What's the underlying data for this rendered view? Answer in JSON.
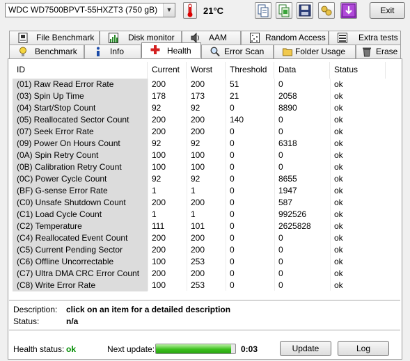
{
  "toolbar": {
    "drive": "WDC WD7500BPVT-55HXZT3 (750 gB)",
    "temperature": "21°C",
    "exit_label": "Exit"
  },
  "tabs_top": [
    {
      "label": "File Benchmark",
      "icon": "file-benchmark-icon"
    },
    {
      "label": "Disk monitor",
      "icon": "disk-monitor-icon"
    },
    {
      "label": "AAM",
      "icon": "speaker-icon"
    },
    {
      "label": "Random Access",
      "icon": "random-access-icon"
    },
    {
      "label": "Extra tests",
      "icon": "extra-tests-icon"
    }
  ],
  "tabs_bottom": [
    {
      "label": "Benchmark",
      "icon": "lightbulb-icon"
    },
    {
      "label": "Info",
      "icon": "info-icon"
    },
    {
      "label": "Health",
      "icon": "health-cross-icon",
      "active": true
    },
    {
      "label": "Error Scan",
      "icon": "magnifier-icon"
    },
    {
      "label": "Folder Usage",
      "icon": "folder-icon"
    },
    {
      "label": "Erase",
      "icon": "trash-icon"
    }
  ],
  "table": {
    "headers": [
      "ID",
      "Current",
      "Worst",
      "Threshold",
      "Data",
      "Status"
    ],
    "rows": [
      [
        "(01) Raw Read Error Rate",
        "200",
        "200",
        "51",
        "0",
        "ok"
      ],
      [
        "(03) Spin Up Time",
        "178",
        "173",
        "21",
        "2058",
        "ok"
      ],
      [
        "(04) Start/Stop Count",
        "92",
        "92",
        "0",
        "8890",
        "ok"
      ],
      [
        "(05) Reallocated Sector Count",
        "200",
        "200",
        "140",
        "0",
        "ok"
      ],
      [
        "(07) Seek Error Rate",
        "200",
        "200",
        "0",
        "0",
        "ok"
      ],
      [
        "(09) Power On Hours Count",
        "92",
        "92",
        "0",
        "6318",
        "ok"
      ],
      [
        "(0A) Spin Retry Count",
        "100",
        "100",
        "0",
        "0",
        "ok"
      ],
      [
        "(0B) Calibration Retry Count",
        "100",
        "100",
        "0",
        "0",
        "ok"
      ],
      [
        "(0C) Power Cycle Count",
        "92",
        "92",
        "0",
        "8655",
        "ok"
      ],
      [
        "(BF) G-sense Error Rate",
        "1",
        "1",
        "0",
        "1947",
        "ok"
      ],
      [
        "(C0) Unsafe Shutdown Count",
        "200",
        "200",
        "0",
        "587",
        "ok"
      ],
      [
        "(C1) Load Cycle Count",
        "1",
        "1",
        "0",
        "992526",
        "ok"
      ],
      [
        "(C2) Temperature",
        "111",
        "101",
        "0",
        "2625828",
        "ok"
      ],
      [
        "(C4) Reallocated Event Count",
        "200",
        "200",
        "0",
        "0",
        "ok"
      ],
      [
        "(C5) Current Pending Sector",
        "200",
        "200",
        "0",
        "0",
        "ok"
      ],
      [
        "(C6) Offline Uncorrectable",
        "100",
        "253",
        "0",
        "0",
        "ok"
      ],
      [
        "(C7) Ultra DMA CRC Error Count",
        "200",
        "200",
        "0",
        "0",
        "ok"
      ],
      [
        "(C8) Write Error Rate",
        "100",
        "253",
        "0",
        "0",
        "ok"
      ]
    ]
  },
  "details": {
    "description_label": "Description:",
    "description_value": "click on an item for a detailed description",
    "status_label": "Status:",
    "status_value": "n/a"
  },
  "footer": {
    "health_label": "Health status:",
    "health_value": "ok",
    "next_update_label": "Next update:",
    "progress": 0.95,
    "timer": "0:03",
    "update_label": "Update",
    "log_label": "Log"
  }
}
